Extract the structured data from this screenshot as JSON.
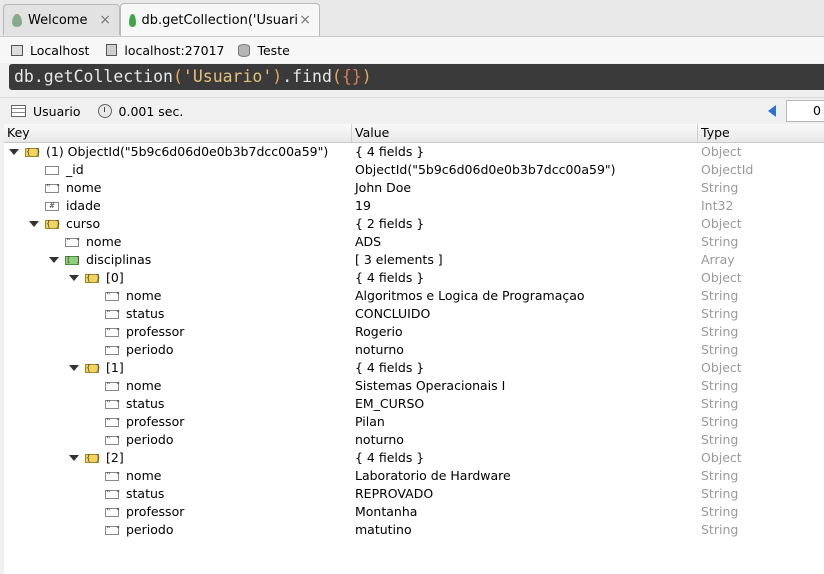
{
  "tabs": [
    {
      "label": "Welcome",
      "close": "×"
    },
    {
      "label": "db.getCollection('Usuari...",
      "close": "×"
    }
  ],
  "connection": {
    "host": "Localhost",
    "server": "localhost:27017",
    "database": "Teste"
  },
  "query": {
    "prefix": "db.getCollection",
    "paren_open": "(",
    "string": "'Usuario'",
    "paren_close": ")",
    "method": ".find",
    "paren2_open": "(",
    "braces": "{}",
    "paren2_close": ")"
  },
  "status": {
    "collection": "Usuario",
    "time": "0.001 sec.",
    "page_value": "0"
  },
  "columns": {
    "key": "Key",
    "value": "Value",
    "type": "Type"
  },
  "rows": [
    {
      "key": "(1) ObjectId(\"5b9c6d06d0e0b3b7dcc00a59\")",
      "value": "{ 4 fields }",
      "type": "Object"
    },
    {
      "key": "_id",
      "value": "ObjectId(\"5b9c6d06d0e0b3b7dcc00a59\")",
      "type": "ObjectId"
    },
    {
      "key": "nome",
      "value": "John Doe",
      "type": "String"
    },
    {
      "key": "idade",
      "value": "19",
      "type": "Int32"
    },
    {
      "key": "curso",
      "value": "{ 2 fields }",
      "type": "Object"
    },
    {
      "key": "nome",
      "value": "ADS",
      "type": "String"
    },
    {
      "key": "disciplinas",
      "value": "[ 3 elements ]",
      "type": "Array"
    },
    {
      "key": "[0]",
      "value": "{ 4 fields }",
      "type": "Object"
    },
    {
      "key": "nome",
      "value": "Algoritmos e Logica de Programaçao",
      "type": "String"
    },
    {
      "key": "status",
      "value": "CONCLUIDO",
      "type": "String"
    },
    {
      "key": "professor",
      "value": "Rogerio",
      "type": "String"
    },
    {
      "key": "periodo",
      "value": "noturno",
      "type": "String"
    },
    {
      "key": "[1]",
      "value": "{ 4 fields }",
      "type": "Object"
    },
    {
      "key": "nome",
      "value": "Sistemas Operacionais I",
      "type": "String"
    },
    {
      "key": "status",
      "value": "EM_CURSO",
      "type": "String"
    },
    {
      "key": "professor",
      "value": "Pilan",
      "type": "String"
    },
    {
      "key": "periodo",
      "value": "noturno",
      "type": "String"
    },
    {
      "key": "[2]",
      "value": "{ 4 fields }",
      "type": "Object"
    },
    {
      "key": "nome",
      "value": "Laboratorio de Hardware",
      "type": "String"
    },
    {
      "key": "status",
      "value": "REPROVADO",
      "type": "String"
    },
    {
      "key": "professor",
      "value": "Montanha",
      "type": "String"
    },
    {
      "key": "periodo",
      "value": "matutino",
      "type": "String"
    }
  ]
}
